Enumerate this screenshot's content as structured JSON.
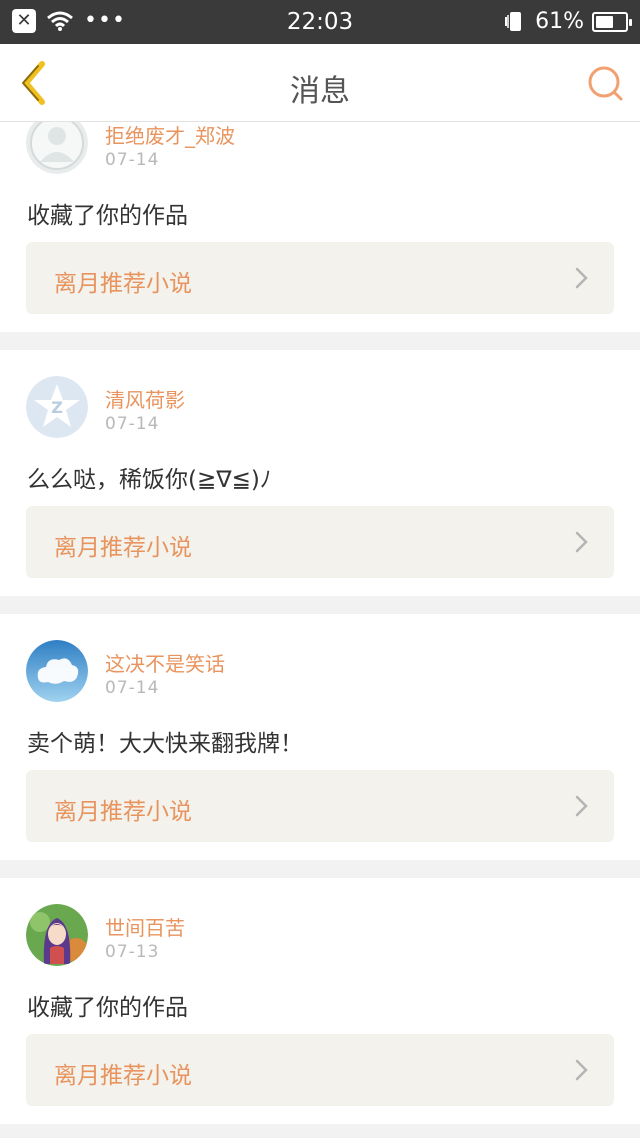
{
  "status_bar": {
    "close_glyph": "✕",
    "signal_dots": "•••",
    "time": "22:03",
    "battery_percent": "61%",
    "battery_level": 0.61
  },
  "nav": {
    "title": "消息",
    "back_icon": "chevron-left-icon",
    "search_icon": "search-icon",
    "accent_back": "#f0c020",
    "accent_search": "#f2a070"
  },
  "colors": {
    "accent": "#e8945e",
    "card_link_bg": "#f3f2ec",
    "page_bg": "#f2f2f2"
  },
  "messages": [
    {
      "username": "拒绝废才_郑波",
      "date": "07-14",
      "text": "收藏了你的作品",
      "work_title": "离月推荐小说",
      "avatar": "default-avatar"
    },
    {
      "username": "清风荷影",
      "date": "07-14",
      "text": "么么哒，稀饭你(≧∇≦)ﾉ",
      "work_title": "离月推荐小说",
      "avatar": "qq-star-avatar"
    },
    {
      "username": "这决不是笑话",
      "date": "07-14",
      "text": "卖个萌！大大快来翻我牌！",
      "work_title": "离月推荐小说",
      "avatar": "cloud-avatar"
    },
    {
      "username": "世间百苦",
      "date": "07-13",
      "text": "收藏了你的作品",
      "work_title": "离月推荐小说",
      "avatar": "anime-girl-avatar"
    }
  ]
}
